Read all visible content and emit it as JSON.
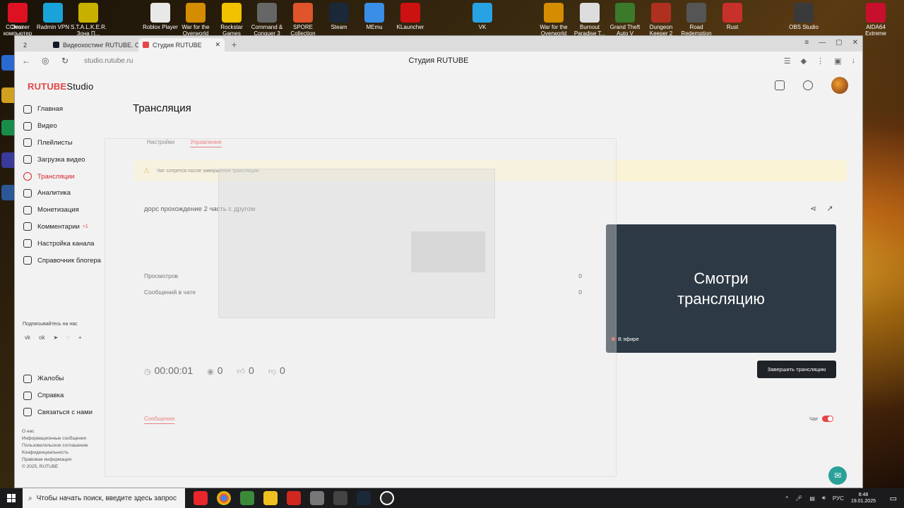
{
  "desktop": {
    "icons": [
      {
        "label": "Этот компьютер",
        "color": "#1f6fd6"
      },
      {
        "label": "Radmin VPN",
        "color": "#1aa3d8"
      },
      {
        "label": "S.T.A.L.K.E.R. Зона П...",
        "color": "#c8b000"
      },
      {
        "label": "",
        "color": "#2a2a2a"
      },
      {
        "label": "Roblox Player",
        "color": "#e8e8e8"
      },
      {
        "label": "War for the Overworld",
        "color": "#d48c00"
      },
      {
        "label": "Rockstar Games",
        "color": "#f2c200"
      },
      {
        "label": "Command & Conquer 3",
        "color": "#666"
      },
      {
        "label": "SPORE Collection",
        "color": "#e0542b"
      },
      {
        "label": "Steam",
        "color": "#1b2838"
      },
      {
        "label": "MEmu",
        "color": "#3a8ee6"
      },
      {
        "label": "KLauncher",
        "color": "#cc1111"
      },
      {
        "label": "",
        "color": "#2a2a2a"
      },
      {
        "label": "VK",
        "color": "#27a3e4"
      },
      {
        "label": "",
        "color": "#2a2a2a"
      },
      {
        "label": "War for the Overworld",
        "color": "#d48c00"
      },
      {
        "label": "Burnout Paradise T...",
        "color": "#ddd"
      },
      {
        "label": "Grand Theft Auto V",
        "color": "#3a7a2a"
      },
      {
        "label": "Dungeon Keeper 2",
        "color": "#b03020"
      },
      {
        "label": "Road Redemption",
        "color": "#555"
      },
      {
        "label": "Rust",
        "color": "#c8302b"
      },
      {
        "label": "",
        "color": "#2a2a2a"
      },
      {
        "label": "OBS Studio",
        "color": "#3a3a3a"
      },
      {
        "label": "",
        "color": "#2a2a2a"
      },
      {
        "label": "AIDA64 Extreme",
        "color": "#c8102e"
      },
      {
        "label": "CCleaner",
        "color": "#d12"
      }
    ]
  },
  "browser": {
    "tab_count": "2",
    "tab1": "Видеохостинг RUTUBE. С...",
    "tab2": "Студия RUTUBE",
    "url": "studio.rutube.ru",
    "page_title": "Студия RUTUBE"
  },
  "sidebar": {
    "logo_brand": "RUTUBE",
    "logo_suffix": "Studio",
    "items": [
      {
        "label": "Главная"
      },
      {
        "label": "Видео"
      },
      {
        "label": "Плейлисты"
      },
      {
        "label": "Загрузка видео"
      },
      {
        "label": "Трансляции"
      },
      {
        "label": "Аналитика"
      },
      {
        "label": "Монетизация"
      },
      {
        "label": "Комментарии",
        "badge": "+1"
      },
      {
        "label": "Настройка канала"
      },
      {
        "label": "Справочник блогера"
      }
    ],
    "subscribe": "Подписывайтесь на нас",
    "items2": [
      {
        "label": "Жалобы"
      },
      {
        "label": "Справка"
      },
      {
        "label": "Связаться с нами"
      }
    ],
    "footer": [
      "О нас",
      "Информационные сообщения",
      "Пользовательское соглашение",
      "Конфиденциальность",
      "Правовая информация",
      "© 2025, RUTUBE"
    ]
  },
  "main": {
    "heading": "Трансляция",
    "tabs": [
      "Настройки",
      "Управление"
    ],
    "notice": "Чат сотрется после завершения трансляции",
    "stream_title": "дорс прохождение 2 часть с другом",
    "stats": [
      {
        "label": "Просмотров",
        "value": "0"
      },
      {
        "label": "Сообщений в чате",
        "value": "0"
      }
    ],
    "timer": "00:00:01",
    "viewers": "0",
    "likes": "0",
    "dislikes": "0",
    "preview_text": "Смотри трансляцию",
    "on_air": "В эфире",
    "end_button": "Завершить трансляцию",
    "messages_tab": "Сообщения",
    "chat_label": "Чат"
  },
  "taskbar": {
    "search_placeholder": "Чтобы начать поиск, введите здесь запрос",
    "lang": "РУС",
    "time": "8:48",
    "date": "19.01.2025"
  }
}
